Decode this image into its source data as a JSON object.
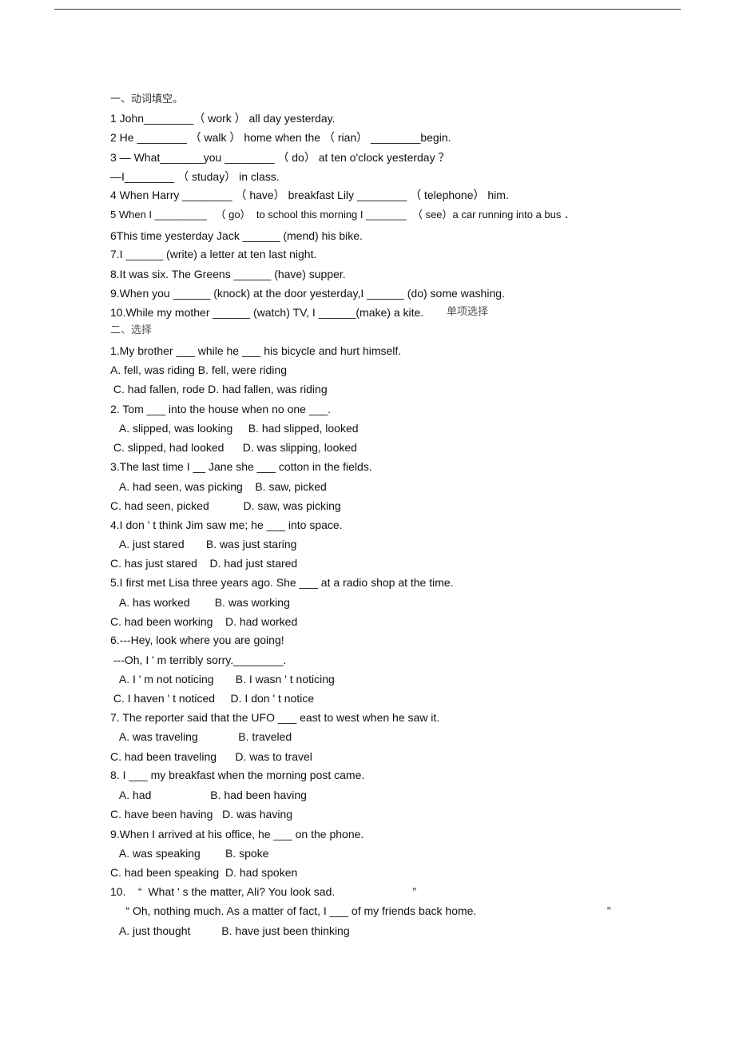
{
  "header_rule": true,
  "section1": {
    "title": "一、动词填空。",
    "items": [
      "1 John________（ work ） all day yesterday.",
      "2 He ________ （ walk ） home when the （ rian） ________begin.",
      "3 — What_______you ________ （ do） at ten o'clock yesterday ？",
      "—I________ （ studay） in class.",
      "4 When Harry ________ （ have） breakfast Lily ________ （ telephone） him.",
      "5 When I _________   （ go）  to school this morning I _______  （ see）a car running into a bus ．",
      "6This time yesterday Jack ______ (mend) his bike.",
      "7.I ______ (write) a letter at ten last night.",
      "8.It was six. The Greens ______ (have) supper.",
      "9.When you ______ (knock) at the door yesterday,I ______ (do) some washing.",
      "10.While my mother ______ (watch) TV, I ______(make) a kite."
    ],
    "trailing_note": "单项选择"
  },
  "section2": {
    "title": "二、选择",
    "lines": [
      "1.My brother ___ while he ___ his bicycle and hurt himself.",
      "A. fell, was riding B. fell, were riding",
      " C. had fallen, rode D. had fallen, was riding",
      "2. Tom ___ into the house when no one ___.",
      "   A. slipped, was looking     B. had slipped, looked",
      " C. slipped, had looked      D. was slipping, looked",
      "3.The last time I __ Jane she ___ cotton in the fields.",
      "   A. had seen, was picking    B. saw, picked",
      "C. had seen, picked           D. saw, was picking",
      "4.I don ' t think Jim saw me; he ___ into space.",
      "   A. just stared       B. was just staring",
      "C. has just stared    D. had just stared",
      "5.I first met Lisa three years ago. She ___ at a radio shop at the time.",
      "   A. has worked        B. was working",
      "C. had been working    D. had worked",
      "6.---Hey, look where you are going!",
      " ---Oh, I ' m terribly sorry.________.",
      "   A. I ' m not noticing       B. I wasn ' t noticing",
      " C. I haven ' t noticed     D. I don ' t notice",
      "7. The reporter said that the UFO ___ east to west when he saw it.",
      "   A. was traveling             B. traveled",
      "C. had been traveling      D. was to travel",
      "8. I ___ my breakfast when the morning post came.",
      "   A. had                   B. had been having",
      "C. have been having   D. was having",
      "9.When I arrived at his office, he ___ on the phone.",
      "   A. was speaking        B. spoke",
      "C. had been speaking  D. had spoken",
      "10.    “  What ' s the matter, Ali? You look sad.                         ”",
      "     “ Oh, nothing much. As a matter of fact, I ___ of my friends back home.                                          ”",
      "   A. just thought          B. have just been thinking"
    ]
  }
}
